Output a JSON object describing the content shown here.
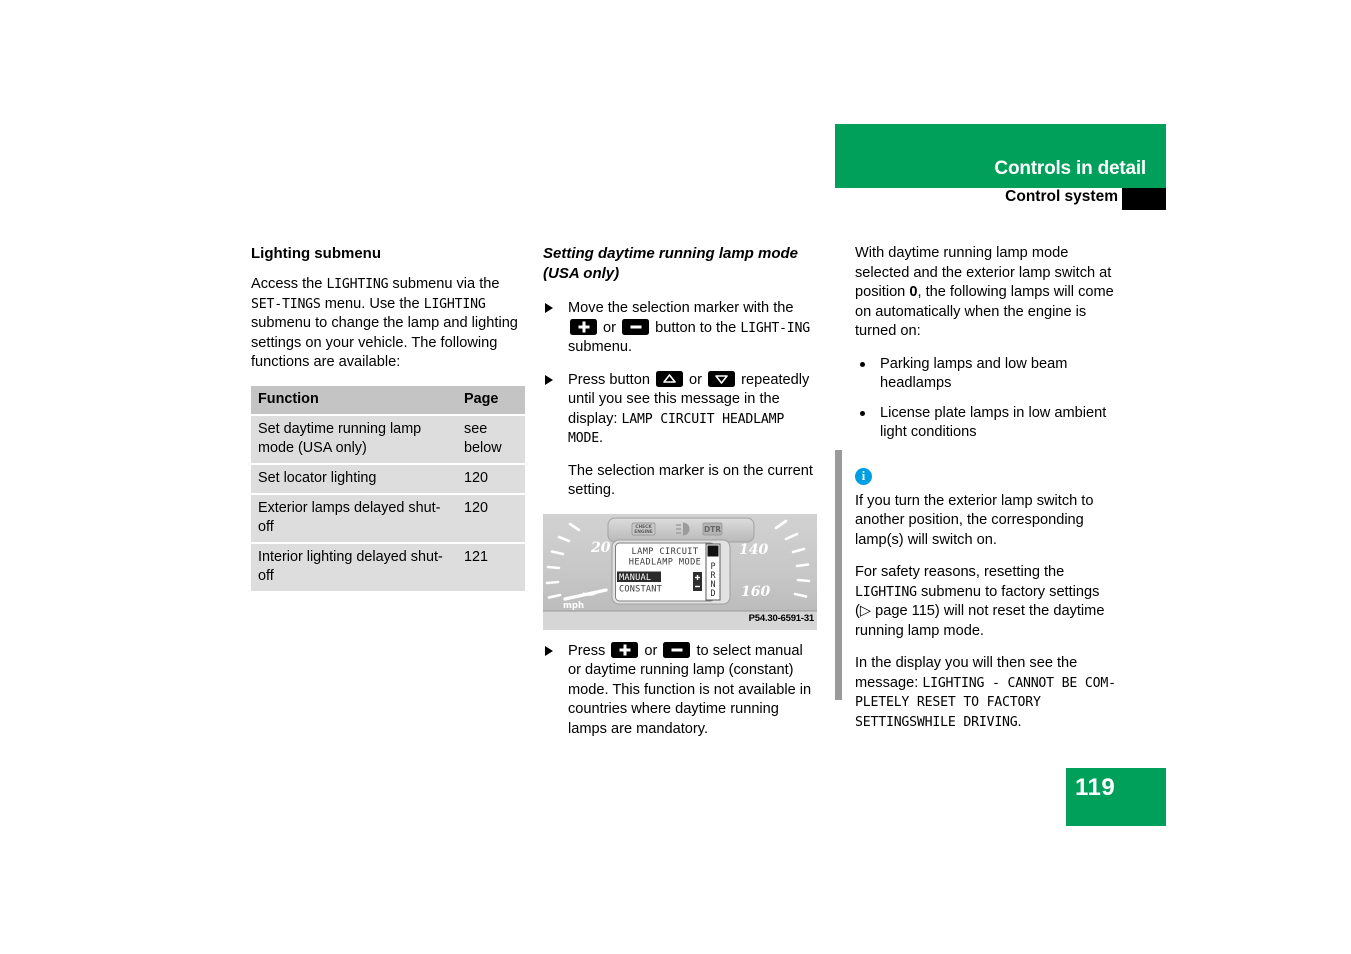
{
  "header": {
    "chapter": "Controls in detail",
    "section": "Control system",
    "green": "#00a05a"
  },
  "left_column": {
    "title": "Lighting submenu",
    "intro_parts": {
      "p1": "Access the ",
      "m1": "LIGHTING",
      "p2": " submenu via the ",
      "m2": "SET-",
      "m3": "TINGS",
      "p3": " menu. Use the ",
      "m4": "LIGHTING",
      "p4": " submenu to change the lamp and lighting settings on your vehicle. The following functions are available:"
    },
    "table": {
      "headers": [
        "Function",
        "Page"
      ],
      "rows": [
        {
          "function": "Set daytime running lamp mode (USA only)",
          "page": "see below"
        },
        {
          "function": "Set locator lighting",
          "page": "120"
        },
        {
          "function": "Exterior lamps delayed shut-off",
          "page": "120"
        },
        {
          "function": "Interior lighting delayed shut-off",
          "page": "121"
        }
      ]
    }
  },
  "middle_column": {
    "title": "Setting daytime running lamp mode (USA only)",
    "step1": {
      "t1": "Move the selection marker with the ",
      "t2": " or ",
      "t3": " button to the ",
      "m1": "LIGHT-",
      "m2": "ING",
      "t4": " submenu."
    },
    "step2": {
      "t1": "Press button ",
      "t2": " or ",
      "t3": " repeatedly until you see this message in the display: ",
      "m1": "LAMP CIRCUIT HEADLAMP MODE",
      "t4": "."
    },
    "step2_note": "The selection marker is on the current setting.",
    "figure": {
      "caption": "P54.30-6591-31",
      "display_line1": "LAMP CIRCUIT",
      "display_line2": "HEADLAMP MODE",
      "option_selected": "MANUAL",
      "option_other": "CONSTANT",
      "gear_letters": "PRND",
      "speed_left": "20",
      "speed_right_1": "140",
      "speed_right_2": "160",
      "unit": "mph",
      "tell_tale_1": "CHECK ENGINE",
      "tell_tale_2": "low-beam-icon",
      "tell_tale_3": "DTR"
    },
    "step3": {
      "t1": "Press ",
      "t2": " or ",
      "t3": " to select manual or daytime running lamp (constant) mode. This function is not available in countries where daytime running lamps are mandatory."
    }
  },
  "right_column": {
    "intro_parts": {
      "p1": "With daytime running lamp mode selected and the exterior lamp switch at position ",
      "b1": "0",
      "p2": ", the following lamps will come on automatically when the engine is turned on:"
    },
    "bullets": [
      "Parking lamps and low beam headlamps",
      "License plate lamps in low ambient light conditions"
    ],
    "note": {
      "icon": "info-icon",
      "icon_char": "i",
      "icon_color": "#009fe3",
      "p1": "If you turn the exterior lamp switch to another position, the corresponding lamp(s) will switch on.",
      "p2_parts": {
        "t1": "For safety reasons, resetting the ",
        "m1": "LIGHTING",
        "t2": " submenu to factory settings (▷ page 115) will not reset the daytime running lamp mode."
      },
      "p3_parts": {
        "t1": "In the display you will then see the mes",
        "t2": "sage: ",
        "m1": "LIGHTING - CANNOT BE COM-",
        "m2": "PLETELY RESET TO FACTORY SETTINGS",
        "m3": "WHILE DRIVING",
        "t3": "."
      }
    }
  },
  "footer": {
    "page_number": "119"
  }
}
